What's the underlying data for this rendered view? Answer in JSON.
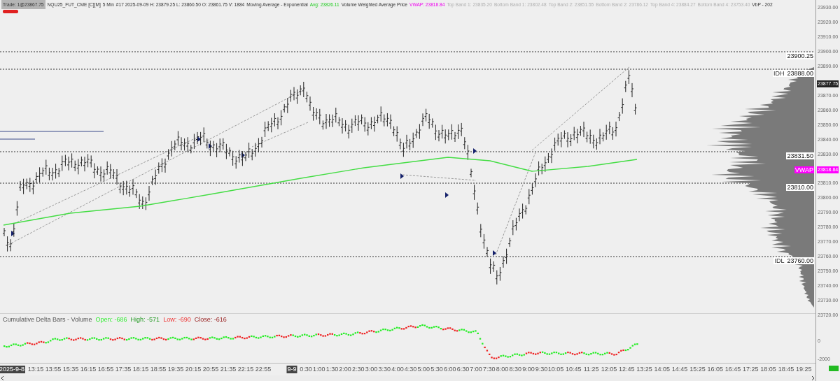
{
  "header": {
    "trade": "Trade: 1@23867.75",
    "items": [
      {
        "kind": "plain",
        "text": "NQU25_FUT_CME [C][M]"
      },
      {
        "kind": "plain",
        "text": "5 Min"
      },
      {
        "kind": "plain",
        "text": "#17 2025-09-09 H: 23879.25 L: 23860.50 O: 23861.75 V: 1884"
      },
      {
        "kind": "plain",
        "text": "Moving Average - Exponential"
      },
      {
        "kind": "avg",
        "text": "Avg: 23826.11"
      },
      {
        "kind": "plain",
        "text": "Volume Weighted Average Price"
      },
      {
        "kind": "vwap",
        "text": "VWAP: 23818.84"
      },
      {
        "kind": "band",
        "text": "Top Band 1: 23835.20"
      },
      {
        "kind": "band",
        "text": "Bottom Band 1: 23802.48"
      },
      {
        "kind": "band",
        "text": "Top Band 2: 23851.55"
      },
      {
        "kind": "band",
        "text": "Bottom Band 2: 23786.12"
      },
      {
        "kind": "band",
        "text": "Top Band 4: 23884.27"
      },
      {
        "kind": "band",
        "text": "Bottom Band 4: 23753.40"
      },
      {
        "kind": "plain",
        "text": "VbP - 202"
      }
    ]
  },
  "levels": [
    {
      "kind": "line",
      "value": "23900.25"
    },
    {
      "kind": "line",
      "tag": "IDH",
      "value": "23888.00"
    },
    {
      "kind": "line",
      "value": "23831.50"
    },
    {
      "kind": "vwap",
      "tag": "VWAP"
    },
    {
      "kind": "line",
      "value": "23810.00"
    },
    {
      "kind": "line",
      "tag": "IDL",
      "value": "23760.00"
    }
  ],
  "price_axis": {
    "ticks": [
      "23930.00",
      "23920.00",
      "23910.00",
      "23900.00",
      "23890.00",
      "23870.00",
      "23860.00",
      "23850.00",
      "23840.00",
      "23830.00",
      "23810.00",
      "23800.00",
      "23790.00",
      "23780.00",
      "23770.00",
      "23760.00",
      "23750.00",
      "23740.00",
      "23730.00",
      "23720.00"
    ],
    "last_price": "23877.75",
    "vwap_price": "23818.84"
  },
  "delta_panel": {
    "items": [
      {
        "kind": "title",
        "text": "Cumulative Delta Bars - Volume"
      },
      {
        "kind": "open",
        "text": "Open: -686"
      },
      {
        "kind": "high",
        "text": "High: -571"
      },
      {
        "kind": "low",
        "text": "Low: -690"
      },
      {
        "kind": "close",
        "text": "Close: -616"
      }
    ],
    "ticks": [
      "0",
      "-2000"
    ]
  },
  "time_axis": [
    {
      "kind": "date",
      "text": "2025-9-8"
    },
    {
      "kind": "time",
      "text": "13:15"
    },
    {
      "kind": "time",
      "text": "13:55"
    },
    {
      "kind": "time",
      "text": "15:35"
    },
    {
      "kind": "time",
      "text": "16:15"
    },
    {
      "kind": "time",
      "text": "16:55"
    },
    {
      "kind": "time",
      "text": "17:35"
    },
    {
      "kind": "time",
      "text": "18:15"
    },
    {
      "kind": "time",
      "text": "18:55"
    },
    {
      "kind": "time",
      "text": "19:35"
    },
    {
      "kind": "time",
      "text": "20:15"
    },
    {
      "kind": "time",
      "text": "20:55"
    },
    {
      "kind": "time",
      "text": "21:35"
    },
    {
      "kind": "time",
      "text": "22:15"
    },
    {
      "kind": "time",
      "text": "22:55"
    },
    {
      "kind": "date",
      "text": "9-9"
    },
    {
      "kind": "time",
      "text": "0:30"
    },
    {
      "kind": "time",
      "text": "1:00"
    },
    {
      "kind": "time",
      "text": "1:30"
    },
    {
      "kind": "time",
      "text": "2:00"
    },
    {
      "kind": "time",
      "text": "2:30"
    },
    {
      "kind": "time",
      "text": "3:00"
    },
    {
      "kind": "time",
      "text": "3:30"
    },
    {
      "kind": "time",
      "text": "4:00"
    },
    {
      "kind": "time",
      "text": "4:30"
    },
    {
      "kind": "time",
      "text": "5:00"
    },
    {
      "kind": "time",
      "text": "5:30"
    },
    {
      "kind": "time",
      "text": "6:00"
    },
    {
      "kind": "time",
      "text": "6:30"
    },
    {
      "kind": "time",
      "text": "7:00"
    },
    {
      "kind": "time",
      "text": "7:30"
    },
    {
      "kind": "time",
      "text": "8:00"
    },
    {
      "kind": "time",
      "text": "8:30"
    },
    {
      "kind": "time",
      "text": "9:00"
    },
    {
      "kind": "time",
      "text": "9:30"
    },
    {
      "kind": "time",
      "text": "10:05"
    },
    {
      "kind": "time",
      "text": "10:45"
    },
    {
      "kind": "time",
      "text": "11:25"
    },
    {
      "kind": "time",
      "text": "12:05"
    },
    {
      "kind": "time",
      "text": "12:45"
    },
    {
      "kind": "time",
      "text": "13:25"
    },
    {
      "kind": "time",
      "text": "14:05"
    },
    {
      "kind": "time",
      "text": "14:45"
    },
    {
      "kind": "time",
      "text": "15:25"
    },
    {
      "kind": "time",
      "text": "16:05"
    },
    {
      "kind": "time",
      "text": "16:45"
    },
    {
      "kind": "time",
      "text": "17:25"
    },
    {
      "kind": "time",
      "text": "18:05"
    },
    {
      "kind": "time",
      "text": "18:45"
    },
    {
      "kind": "time",
      "text": "19:25"
    }
  ]
}
